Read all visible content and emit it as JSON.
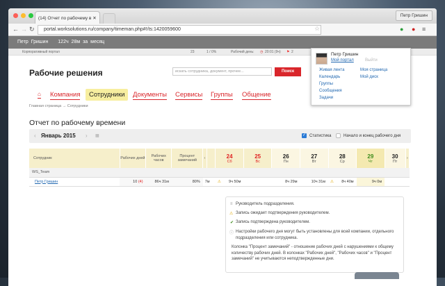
{
  "browser": {
    "tab_title": "(14) Отчет по рабочему в",
    "profile": "Петр Гришин",
    "url": "portal.worksolutions.ru/company/timeman.php#!/ts:1420059600"
  },
  "userbar": {
    "name": "Петр Гришин",
    "summary": "122ч 28м за месяц"
  },
  "toolbar": {
    "portal": "Корпоративный портал",
    "count1": "23",
    "count2": "1 / 0%",
    "workday_label": "Рабочий день:",
    "workday_time": "20:01 (9ч)",
    "flags": "2"
  },
  "header": {
    "brand": "Рабочие решения",
    "search_placeholder": "искать сотрудника, документ, прочее...",
    "search_button": "Поиск"
  },
  "menu": [
    "Компания",
    "Сотрудники",
    "Документы",
    "Сервисы",
    "Группы",
    "Общение"
  ],
  "breadcrumb": "Главная страница → Сотрудники",
  "page_title": "Отчет по рабочему времени",
  "calendar": {
    "month": "Январь 2015",
    "stat_label": "Статистика",
    "stat_checked": true,
    "startend_label": "Начало и конец рабочего дня",
    "startend_checked": false
  },
  "table": {
    "headers": [
      "Сотрудник",
      "Рабочих дней",
      "Рабочих часов",
      "Процент замечаний"
    ],
    "days": [
      {
        "n": "24",
        "w": "Сб",
        "c": "red"
      },
      {
        "n": "25",
        "w": "Вс",
        "c": "red"
      },
      {
        "n": "26",
        "w": "Пн",
        "c": ""
      },
      {
        "n": "27",
        "w": "Вт",
        "c": ""
      },
      {
        "n": "28",
        "w": "Ср",
        "c": ""
      },
      {
        "n": "29",
        "w": "Чт",
        "c": "grn"
      },
      {
        "n": "30",
        "w": "Пт",
        "c": ""
      }
    ],
    "group": "WS_Team",
    "row": {
      "name": "Петр Гришин",
      "days": "10",
      "days_warn": "(4)",
      "hours": "86ч 31м",
      "percent": "80%",
      "partial": "7м",
      "cells": [
        "9ч 50м",
        "",
        "8ч 29м",
        "10ч 31м",
        "8ч 40м",
        "9ч 0м",
        ""
      ]
    }
  },
  "popup": {
    "name": "Петр Гришин",
    "my_portal": "Мой портал",
    "logout": "Выйти",
    "links_left": [
      "Живая лента",
      "Календарь",
      "Группы",
      "Сообщения",
      "Задачи"
    ],
    "links_right": [
      "Моя страница",
      "Мой диск"
    ]
  },
  "legend": [
    "Руководитель подразделения.",
    "Запись ожидает подтверждения руководителем.",
    "Запись подтверждена руководителем.",
    "Настройки рабочего дня могут быть установлены для всей компании, отдельного подразделения или сотрудника.",
    "Колонка \"Процент замечаний\" - отношение рабочих дней с нарушениями к общему количеству рабочих дней. В колонках \"Рабочих дней\", \"Рабочих часов\" и \"Процент замечаний\" не учитываются неподтвержденные дни."
  ]
}
